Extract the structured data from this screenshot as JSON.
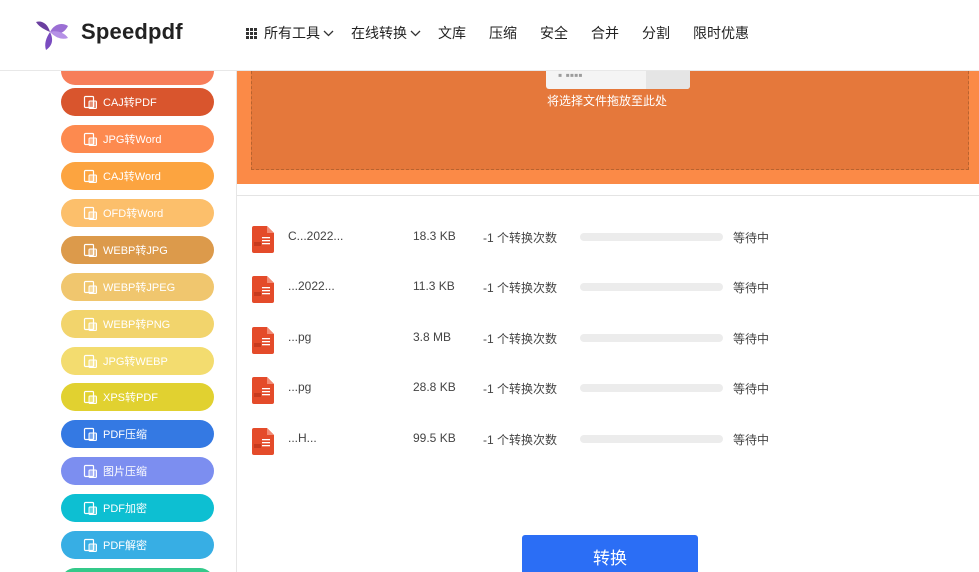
{
  "brand": {
    "name": "Speedpdf"
  },
  "nav": {
    "all_tools": "所有工具",
    "online_convert": "在线转换",
    "library": "文库",
    "compress": "压缩",
    "security": "安全",
    "merge": "合并",
    "split": "分割",
    "offers": "限时优惠"
  },
  "sidebar": {
    "items": [
      {
        "label": "CAJ转PDF",
        "color": "#d9552d",
        "icon": "caj-file-icon"
      },
      {
        "label": "JPG转Word",
        "color": "#fd8a4f",
        "icon": "image-file-icon"
      },
      {
        "label": "CAJ转Word",
        "color": "#fca440",
        "icon": "caj-file-icon"
      },
      {
        "label": "OFD转Word",
        "color": "#fcbf6b",
        "icon": "ofd-file-icon"
      },
      {
        "label": "WEBP转JPG",
        "color": "#dc9a4b",
        "icon": "image-file-icon"
      },
      {
        "label": "WEBP转JPEG",
        "color": "#f0c66e",
        "icon": "image-file-icon"
      },
      {
        "label": "WEBP转PNG",
        "color": "#f2d46c",
        "icon": "image-file-icon"
      },
      {
        "label": "JPG转WEBP",
        "color": "#f3dc6f",
        "icon": "image-file-icon"
      },
      {
        "label": "XPS转PDF",
        "color": "#e1d130",
        "icon": "xps-file-icon"
      },
      {
        "label": "PDF压缩",
        "color": "#3479e3",
        "icon": "compress-icon"
      },
      {
        "label": "图片压缩",
        "color": "#7c8ef0",
        "icon": "image-compress-icon"
      },
      {
        "label": "PDF加密",
        "color": "#0dbfd2",
        "icon": "lock-icon"
      },
      {
        "label": "PDF解密",
        "color": "#37aee4",
        "icon": "unlock-icon"
      }
    ]
  },
  "drop": {
    "hint": "将选择文件拖放至此处"
  },
  "files": [
    {
      "name": "C...2022...",
      "size": "18.3 KB",
      "conversions": "-1 个转换次数",
      "progress": 0,
      "status": "等待中"
    },
    {
      "name": "...2022...",
      "size": "11.3 KB",
      "conversions": "-1 个转换次数",
      "progress": 0,
      "status": "等待中"
    },
    {
      "name": "...pg",
      "size": "3.8 MB",
      "conversions": "-1 个转换次数",
      "progress": 0,
      "status": "等待中"
    },
    {
      "name": "...pg",
      "size": "28.8 KB",
      "conversions": "-1 个转换次数",
      "progress": 0,
      "status": "等待中"
    },
    {
      "name": "...H...",
      "size": "99.5 KB",
      "conversions": "-1 个转换次数",
      "progress": 0,
      "status": "等待中"
    }
  ],
  "actions": {
    "convert": "转换"
  },
  "colors": {
    "accent": "#2b6ef5",
    "dropzone": "#fb8a47",
    "file_icon": "#e44b2a"
  }
}
